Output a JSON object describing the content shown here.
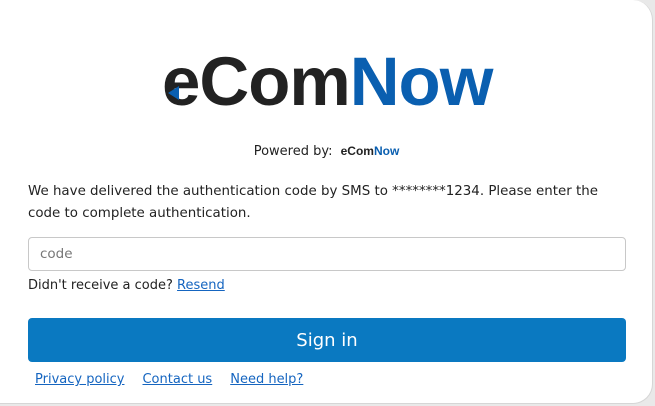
{
  "logo": {
    "brand_first": "eCom",
    "brand_second": "Now",
    "primary_color": "#222222",
    "accent_color": "#0a5fb0"
  },
  "powered": {
    "label": "Powered by:",
    "brand_first": "eCom",
    "brand_second": "Now"
  },
  "message": "We have delivered the authentication code by SMS to ********1234. Please enter the code to complete authentication.",
  "code_input": {
    "placeholder": "code",
    "value": ""
  },
  "resend": {
    "prompt": "Didn't receive a code?",
    "link": "Resend"
  },
  "signin": {
    "label": "Sign in",
    "color": "#0a79c1"
  },
  "footer": {
    "privacy": "Privacy policy",
    "contact": "Contact us",
    "help": "Need help?"
  }
}
